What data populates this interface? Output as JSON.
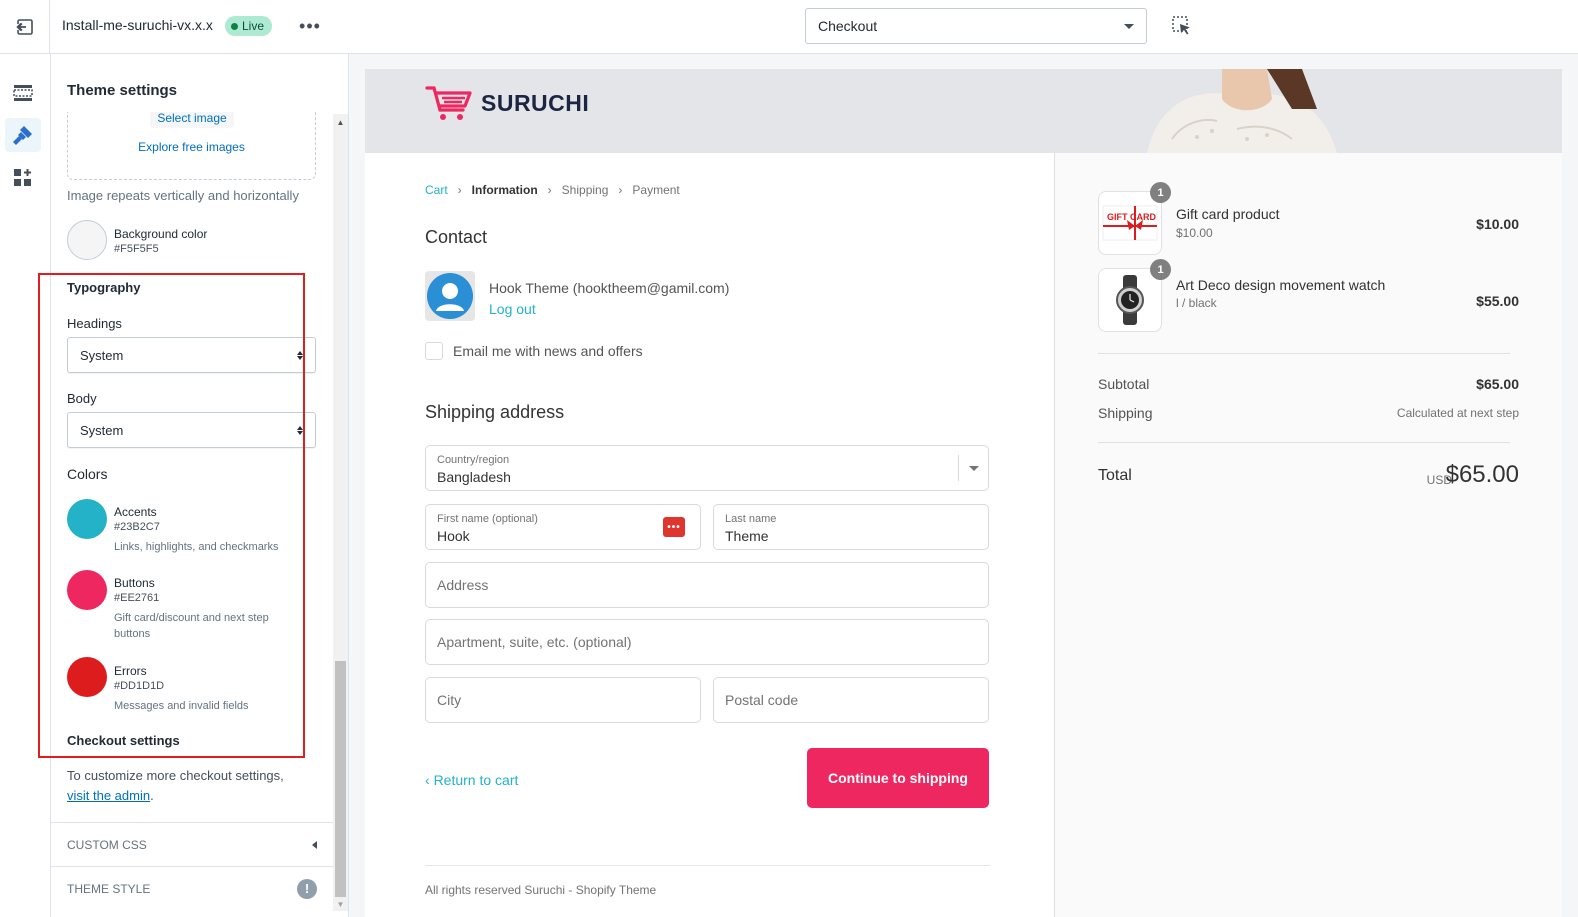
{
  "topbar": {
    "theme_name": "Install-me-suruchi-vx.x.x",
    "live_badge": "Live",
    "more_label": "•••",
    "page_select_value": "Checkout"
  },
  "panel": {
    "title": "Theme settings",
    "select_image_label": "Select image",
    "explore_free_images_label": "Explore free images",
    "image_repeat_note": "Image repeats vertically and horizontally",
    "background_color": {
      "label": "Background color",
      "hex": "#F5F5F5"
    },
    "typography": {
      "heading": "Typography",
      "headings_label": "Headings",
      "headings_value": "System",
      "body_label": "Body",
      "body_value": "System"
    },
    "colors": {
      "heading": "Colors",
      "items": [
        {
          "label": "Accents",
          "hex": "#23B2C7",
          "desc": "Links, highlights, and checkmarks"
        },
        {
          "label": "Buttons",
          "hex": "#EE2761",
          "desc": "Gift card/discount and next step buttons"
        },
        {
          "label": "Errors",
          "hex": "#DD1D1D",
          "desc": "Messages and invalid fields"
        }
      ]
    },
    "checkout_settings": {
      "heading": "Checkout settings",
      "text": "To customize more checkout settings,",
      "link": "visit the admin",
      "tail": "."
    },
    "custom_css_label": "CUSTOM CSS",
    "theme_style_label": "THEME STYLE"
  },
  "checkout": {
    "logo_text": "SURUCHI",
    "breadcrumb": [
      "Cart",
      "Information",
      "Shipping",
      "Payment"
    ],
    "contact_heading": "Contact",
    "user_name": "Hook Theme (hooktheem@gamil.com)",
    "logout_label": "Log out",
    "newsletter_label": "Email me with news and offers",
    "shipping_heading": "Shipping address",
    "country_label": "Country/region",
    "country_value": "Bangladesh",
    "first_name_label": "First name (optional)",
    "first_name_value": "Hook",
    "last_name_label": "Last name",
    "last_name_value": "Theme",
    "address_placeholder": "Address",
    "apartment_placeholder": "Apartment, suite, etc. (optional)",
    "city_placeholder": "City",
    "postal_placeholder": "Postal code",
    "return_label": "Return to cart",
    "continue_label": "Continue to shipping",
    "footer": "All rights reserved Suruchi - Shopify Theme"
  },
  "summary": {
    "items": [
      {
        "name": "Gift card product",
        "sub": "$10.00",
        "price": "$10.00",
        "qty": "1"
      },
      {
        "name": "Art Deco design movement watch",
        "sub": "l / black",
        "price": "$55.00",
        "qty": "1"
      }
    ],
    "gift_card_thumb_text": "GIFT CARD",
    "subtotal_label": "Subtotal",
    "subtotal_value": "$65.00",
    "shipping_label": "Shipping",
    "shipping_value": "Calculated at next step",
    "total_label": "Total",
    "total_currency": "USD",
    "total_value": "$65.00"
  },
  "colors": {
    "accent": "#23B2C7",
    "button": "#EE2761",
    "error": "#DD1D1D",
    "background": "#F5F5F5",
    "admin_link": "#006fbb",
    "highlight_box": "#e01e1e"
  },
  "icons": [
    "exit-icon",
    "more-icon",
    "inspect-icon",
    "sections-icon",
    "theme-settings-icon",
    "apps-icon",
    "cart-logo-icon",
    "avatar-icon",
    "password-manager-icon",
    "chevron-left-icon",
    "warning-icon"
  ]
}
